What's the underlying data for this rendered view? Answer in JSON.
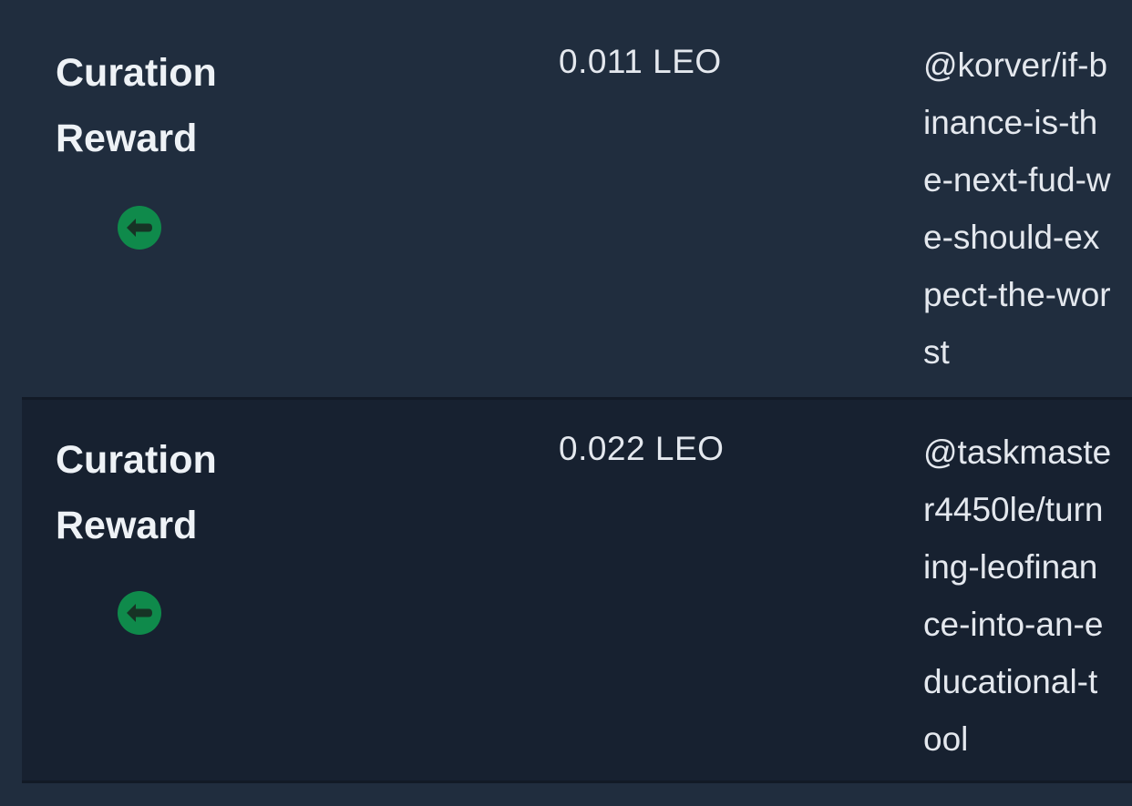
{
  "transactions": [
    {
      "type_line1": "Curation",
      "type_line2": "Reward",
      "icon": "arrow-left-circle-icon",
      "amount": "0.011 LEO",
      "link_lines": [
        "@korver/if-b",
        "inance-is-th",
        "e-next-fud-w",
        "e-should-ex",
        "pect-the-wor",
        "st"
      ]
    },
    {
      "type_line1": "Curation",
      "type_line2": "Reward",
      "icon": "arrow-left-circle-icon",
      "amount": "0.022 LEO",
      "link_lines": [
        "@taskmaste",
        "r4450le/turn",
        "ing-leofinan",
        "ce-into-an-e",
        "ducational-t",
        "ool"
      ]
    }
  ],
  "colors": {
    "background": "#202d3e",
    "alt_row": "#172130",
    "icon_green": "#0f8a4b",
    "text": "#e8ecf1"
  }
}
